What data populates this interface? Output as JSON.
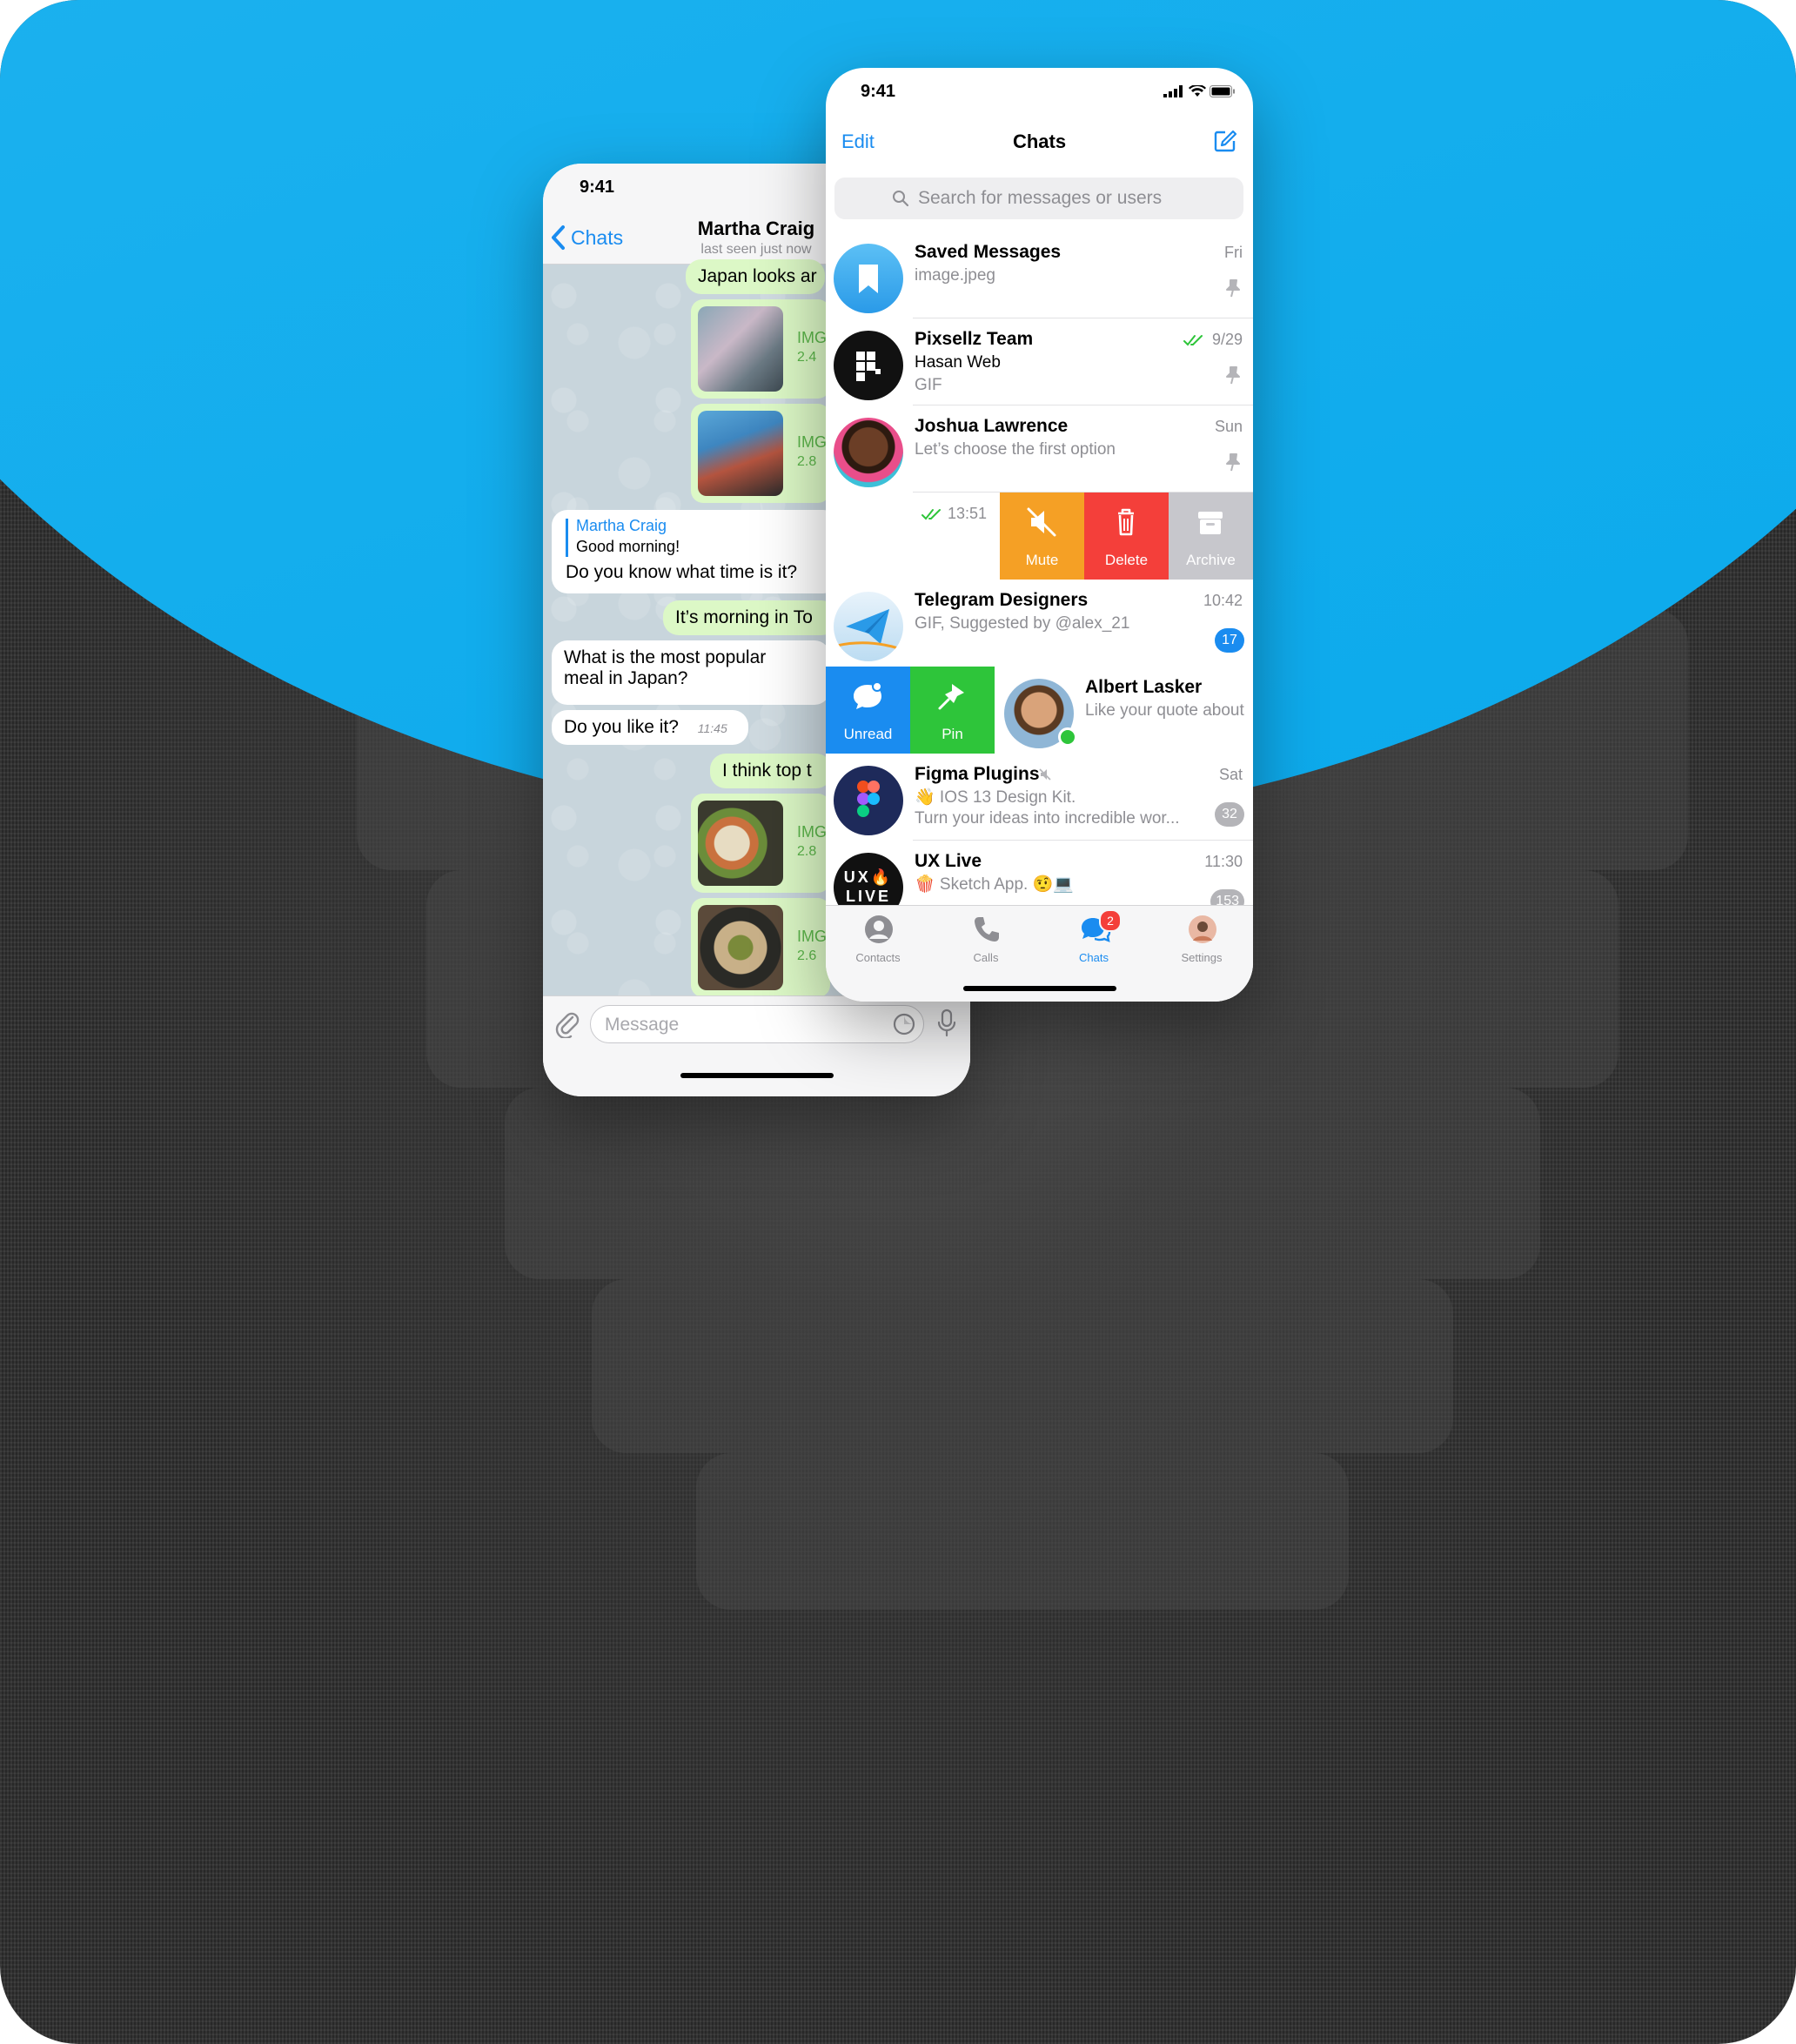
{
  "colors": {
    "accent": "#1a8cf0",
    "bubble_out": "#dcf8c6",
    "mute": "#f5a025",
    "delete": "#f43f3a",
    "archive": "#c7c7cc",
    "unread": "#1a8cf0",
    "pin": "#2ec53a",
    "background_blob": "#0aa9ec"
  },
  "back_phone": {
    "status_time": "9:41",
    "back_label": "Chats",
    "contact_name": "Martha Craig",
    "contact_status": "last seen just now",
    "messages": [
      {
        "text": "Japan looks ar"
      },
      {
        "image_label": "IMG",
        "image_size": "2.4"
      },
      {
        "image_label": "IMG",
        "image_size": "2.8"
      },
      {
        "reply_name": "Martha Craig",
        "reply_text": "Good morning!",
        "text": "Do you know what time is it?"
      },
      {
        "text": "It’s morning in To"
      },
      {
        "text_line1": "What is the most popular",
        "text_line2": "meal in Japan?"
      },
      {
        "text": "Do you like it?",
        "time": "11:45"
      },
      {
        "text": "I think top t"
      },
      {
        "image_label": "IMG",
        "image_size": "2.8"
      },
      {
        "image_label": "IMG",
        "image_size": "2.6"
      }
    ],
    "input_placeholder": "Message"
  },
  "front_phone": {
    "status_time": "9:41",
    "edit_label": "Edit",
    "title": "Chats",
    "search_placeholder": "Search for messages or users",
    "chats": [
      {
        "name": "Saved Messages",
        "line1": "image.jpeg",
        "time": "Fri",
        "icon": "bookmark-icon"
      },
      {
        "name": "Pixsellz Team",
        "line1": "Hasan Web",
        "line2": "GIF",
        "time": "9/29"
      },
      {
        "name": "Joshua Lawrence",
        "line1": "Let’s choose the first option",
        "time": "Sun"
      },
      {
        "time": "13:51"
      },
      {
        "name": "Telegram Designers",
        "line1": "GIF, Suggested by @alex_21",
        "time": "10:42",
        "badge": "17"
      },
      {
        "name": "Albert Lasker",
        "line1": "Like your quote about"
      },
      {
        "name": "Figma Plugins",
        "line1": "👋 IOS 13 Design Kit.",
        "line2": "Turn your ideas into incredible wor...",
        "time": "Sat",
        "badge": "32"
      },
      {
        "name": "UX Live",
        "line1": "🍿 Sketch App. 🤨💻",
        "time": "11:30",
        "badge": "153",
        "avatar_text_top": "UX🔥",
        "avatar_text_bottom": "LIVE"
      }
    ],
    "swipe_right_actions": [
      "Mute",
      "Delete",
      "Archive"
    ],
    "swipe_left_actions": [
      "Unread",
      "Pin"
    ],
    "tabs": [
      {
        "label": "Contacts",
        "icon": "contacts-icon"
      },
      {
        "label": "Calls",
        "icon": "phone-icon"
      },
      {
        "label": "Chats",
        "icon": "chat-bubbles-icon",
        "badge": "2",
        "active": true
      },
      {
        "label": "Settings",
        "icon": "avatar-icon"
      }
    ]
  }
}
